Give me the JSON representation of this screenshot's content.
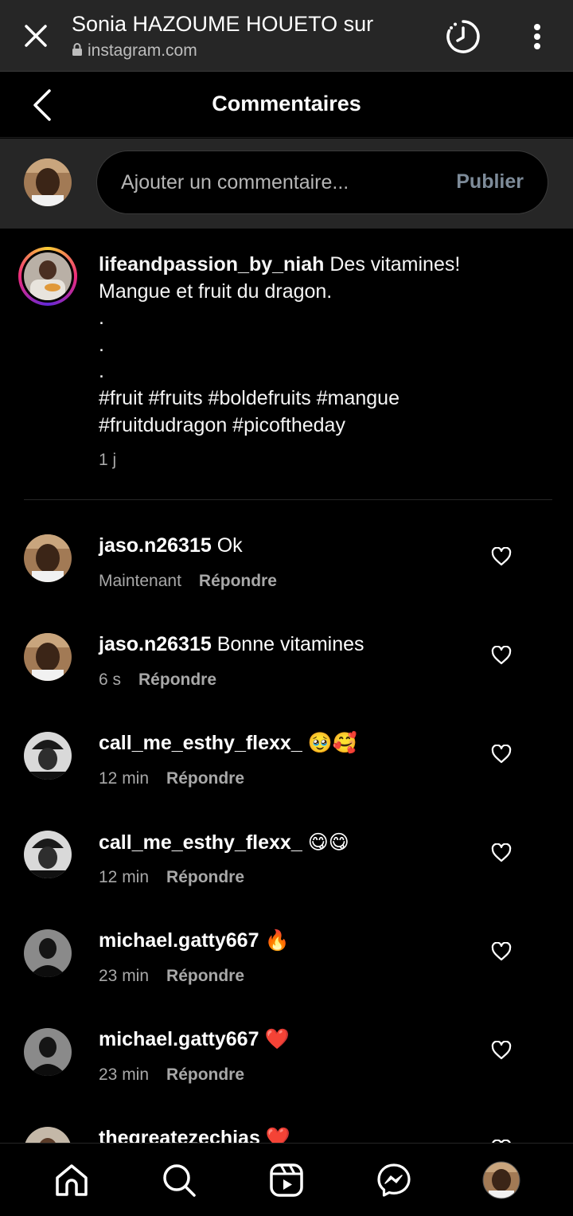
{
  "browser": {
    "title": "Sonia HAZOUME HOUETO sur",
    "url": "instagram.com"
  },
  "header": {
    "title": "Commentaires"
  },
  "composer": {
    "placeholder": "Ajouter un commentaire...",
    "publish_label": "Publier"
  },
  "caption": {
    "username": "lifeandpassion_by_niah",
    "text": "Des vitamines!\nMangue et fruit du dragon.\n.\n.\n.\n#fruit #fruits #boldefruits #mangue\n#fruitdudragon #picoftheday",
    "time": "1 j"
  },
  "comments": [
    {
      "username": "jaso.n26315",
      "text": "Ok",
      "time": "Maintenant",
      "reply": "Répondre"
    },
    {
      "username": "jaso.n26315",
      "text": "Bonne vitamines",
      "time": "6 s",
      "reply": "Répondre"
    },
    {
      "username": "call_me_esthy_flexx_",
      "text": "🥹🥰",
      "time": "12 min",
      "reply": "Répondre"
    },
    {
      "username": "call_me_esthy_flexx_",
      "text": "😋😋",
      "time": "12 min",
      "reply": "Répondre"
    },
    {
      "username": "michael.gatty667",
      "text": "🔥",
      "time": "23 min",
      "reply": "Répondre"
    },
    {
      "username": "michael.gatty667",
      "text": "❤️",
      "time": "23 min",
      "reply": "Répondre"
    },
    {
      "username": "thegreatezechias",
      "text": "❤️",
      "time": "",
      "reply": ""
    }
  ],
  "colors": {
    "background": "#000000",
    "bar": "#262626",
    "muted_text": "#a8a8a8",
    "publish_disabled": "#7d8b99"
  },
  "icons": {
    "browser_close": "close-icon",
    "browser_lock": "lock-icon",
    "browser_history": "history-icon",
    "browser_menu": "more-vertical-icon",
    "back": "chevron-left-icon",
    "like": "heart-icon",
    "nav": [
      "home-icon",
      "search-icon",
      "reels-icon",
      "messenger-icon",
      "profile-avatar"
    ]
  }
}
